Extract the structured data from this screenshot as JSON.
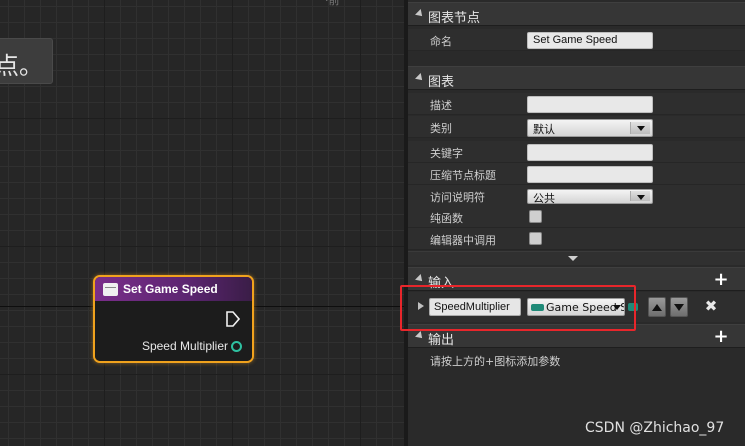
{
  "graph": {
    "comment_text": "点。",
    "top_hint": "·前",
    "node": {
      "title": "Set Game Speed",
      "pin_label": "Speed Multiplier"
    }
  },
  "details": {
    "graph_node_section": {
      "title": "图表节点",
      "name_label": "命名",
      "name_value": "Set Game Speed"
    },
    "graph_section": {
      "title": "图表",
      "description_label": "描述",
      "description_value": "",
      "category_label": "类别",
      "category_value": "默认",
      "keywords_label": "关键字",
      "keywords_value": "",
      "compact_title_label": "压缩节点标题",
      "compact_title_value": "",
      "access_label": "访问说明符",
      "access_value": "公共",
      "pure_label": "纯函数",
      "call_in_editor_label": "编辑器中调用"
    },
    "inputs_section": {
      "title": "输入",
      "param_name": "SpeedMultiplier",
      "param_type": "Game Speed S"
    },
    "outputs_section": {
      "title": "输出",
      "hint": "请按上方的+图标添加参数"
    }
  },
  "watermark": "CSDN @Zhichao_97",
  "colors": {
    "node_border": "#f0a21d",
    "node_header": "#7a2e8a",
    "pin_teal": "#2ec0a0",
    "highlight_red": "#e8262b"
  }
}
